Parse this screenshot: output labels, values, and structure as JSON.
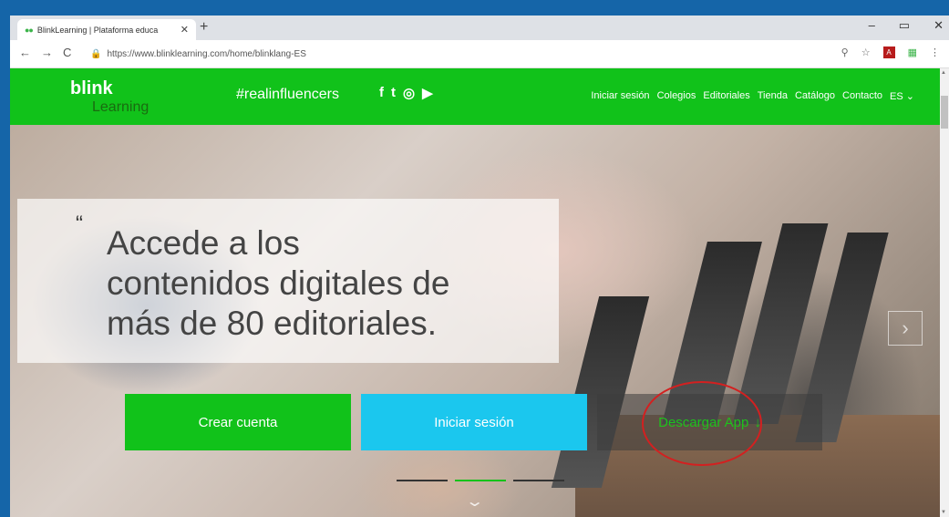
{
  "browser": {
    "tab_title": "BlinkLearning | Plataforma educa",
    "tab_favicon": "●●",
    "tab_close": "✕",
    "new_tab": "+",
    "window_controls": [
      "–",
      "▭",
      "✕"
    ],
    "nav": {
      "back": "←",
      "forward": "→",
      "reload": "C"
    },
    "lock_icon": "🔒",
    "url": "https://www.blinklearning.com/home/blinklang-ES",
    "toolbar_icons": {
      "zoom": "⚲",
      "star": "☆",
      "pdf": "A",
      "menu": "⋮"
    }
  },
  "site": {
    "logo_blink": "blink",
    "logo_learning": "Learning",
    "hashtag": "#realinfluencers",
    "social": [
      "f",
      "t",
      "◎",
      "▶"
    ],
    "nav_links": [
      "Iniciar sesión",
      "Colegios",
      "Editoriales",
      "Tienda",
      "Catálogo",
      "Contacto",
      "ES ⌄"
    ],
    "brand_color": "#11c21a"
  },
  "hero": {
    "quote_mark": "“",
    "headline": "Accede a los contenidos digitales de más de 80 editoriales.",
    "next_arrow": "›",
    "buttons": {
      "create_account": "Crear cuenta",
      "login": "Iniciar sesión",
      "download_app": "Descargar App",
      "download_icon": "↓"
    },
    "carousel_slides": 3,
    "carousel_active": 2,
    "scroll_icon": "⌄"
  }
}
